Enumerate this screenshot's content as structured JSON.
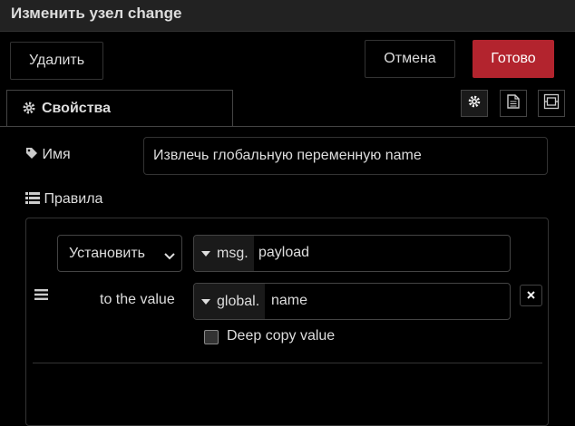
{
  "window": {
    "title": "Изменить узел change"
  },
  "toolbar": {
    "delete_label": "Удалить",
    "cancel_label": "Отмена",
    "done_label": "Готово",
    "done_color": "#b3242e"
  },
  "tabs": {
    "properties_label": "Свойства",
    "icons": [
      "gear-icon",
      "description-icon",
      "appearance-icon"
    ]
  },
  "fields": {
    "name": {
      "label": "Имя",
      "value": "Извлечь глобальную переменную name"
    },
    "rules": {
      "label": "Правила"
    }
  },
  "rules": [
    {
      "action": "Установить",
      "target_type": "msg.",
      "target_value": "payload",
      "to_label": "to the value",
      "source_type": "global.",
      "source_value": "name",
      "deep_copy_label": "Deep copy value",
      "deep_copy": false
    }
  ]
}
